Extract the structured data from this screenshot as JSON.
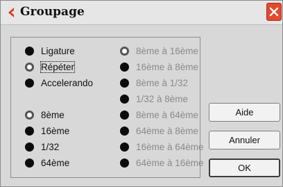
{
  "window": {
    "title": "Groupage"
  },
  "left_column": [
    {
      "label": "Ligature",
      "selected": false
    },
    {
      "label": "Répéter",
      "selected": true
    },
    {
      "label": "Accelerando",
      "selected": false
    },
    {
      "label": "8ème",
      "selected": true
    },
    {
      "label": "16ème",
      "selected": false
    },
    {
      "label": "1/32",
      "selected": false
    },
    {
      "label": "64ème",
      "selected": false
    }
  ],
  "right_column": [
    {
      "label": "8ème à 16ème",
      "selected": true
    },
    {
      "label": "16ème à 8ème",
      "selected": false
    },
    {
      "label": "8ème à 1/32",
      "selected": false
    },
    {
      "label": "1/32 à 8ème",
      "selected": false
    },
    {
      "label": "8ème à 64ème",
      "selected": false
    },
    {
      "label": "64ème à 8ème",
      "selected": false
    },
    {
      "label": "16ème à 64ème",
      "selected": false
    },
    {
      "label": "64ème à 16ème",
      "selected": false
    }
  ],
  "buttons": {
    "help": "Aide",
    "cancel": "Annuler",
    "ok": "OK"
  },
  "colors": {
    "accent_red": "#d93a20",
    "window_bg": "#d8d8d8",
    "disabled_text": "#8a8a8a"
  }
}
